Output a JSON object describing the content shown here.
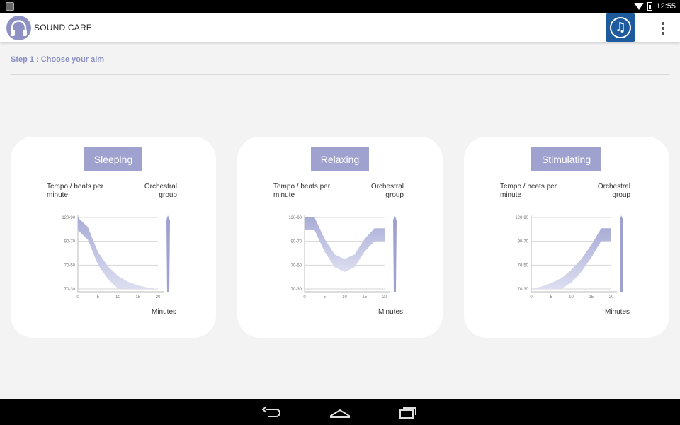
{
  "status_bar": {
    "time": "12:55"
  },
  "app_bar": {
    "title": "SOUND CARE",
    "logo_icon": "headphones-icon",
    "music_icon": "music-note-icon",
    "menu_icon": "overflow-menu-icon"
  },
  "step": {
    "label": "Step 1 : Choose your aim"
  },
  "colors": {
    "accent": "#9fa2cf",
    "curve": "#a9acd6",
    "curve_light": "#dcdef0",
    "brand": "#1e5a9e"
  },
  "cards": [
    {
      "title": "Sleeping",
      "y_axis_title": "Tempo / beats per minute",
      "group_title": "Orchestral group",
      "x_axis_title": "Minutes",
      "chart_data": {
        "type": "area",
        "y_tick_labels": [
          "120-90",
          "90-70",
          "70-50",
          "70-30"
        ],
        "x_tick_labels": [
          "0",
          "5",
          "10",
          "15",
          "20"
        ],
        "x": [
          0,
          2.5,
          5,
          7.5,
          10,
          12.5,
          15,
          17.5,
          20
        ],
        "y": [
          3,
          2.6,
          1.55,
          0.95,
          0.55,
          0.3,
          0.15,
          0.05,
          0
        ],
        "ylim": [
          0,
          3
        ],
        "xlim": [
          0,
          20
        ]
      }
    },
    {
      "title": "Relaxing",
      "y_axis_title": "Tempo / beats per minute",
      "group_title": "Orchestral group",
      "x_axis_title": "Minutes",
      "chart_data": {
        "type": "area",
        "y_tick_labels": [
          "120-90",
          "90-70",
          "70-50",
          "70-30"
        ],
        "x_tick_labels": [
          "0",
          "5",
          "10",
          "15",
          "20"
        ],
        "x": [
          0,
          2.5,
          5,
          7.5,
          10,
          12.5,
          15,
          17.5,
          20
        ],
        "y": [
          3,
          3,
          2.1,
          1.45,
          1.25,
          1.45,
          2.1,
          2.55,
          2.55
        ],
        "ylim": [
          0,
          3
        ],
        "xlim": [
          0,
          20
        ]
      }
    },
    {
      "title": "Stimulating",
      "y_axis_title": "Tempo / beats per minute",
      "group_title": "Orchestral group",
      "x_axis_title": "Minutes",
      "chart_data": {
        "type": "area",
        "y_tick_labels": [
          "120-90",
          "90-70",
          "70-50",
          "70-30"
        ],
        "x_tick_labels": [
          "0",
          "5",
          "10",
          "15",
          "20"
        ],
        "x": [
          0,
          2.5,
          5,
          7.5,
          10,
          12.5,
          15,
          17.5,
          20
        ],
        "y": [
          0,
          0.1,
          0.25,
          0.45,
          0.8,
          1.25,
          1.85,
          2.55,
          2.55
        ],
        "ylim": [
          0,
          3
        ],
        "xlim": [
          0,
          20
        ]
      }
    }
  ],
  "nav_bar": {
    "back_icon": "back-icon",
    "home_icon": "home-icon",
    "recents_icon": "recents-icon"
  }
}
